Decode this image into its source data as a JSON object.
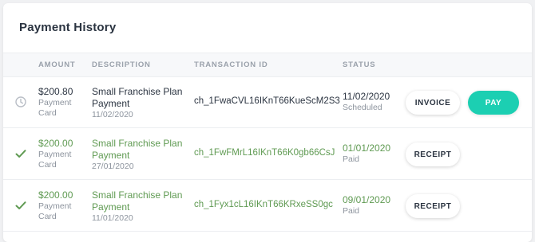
{
  "card": {
    "title": "Payment History"
  },
  "columns": {
    "amount": "AMOUNT",
    "description": "DESCRIPTION",
    "transaction_id": "TRANSACTION ID",
    "status": "STATUS"
  },
  "rows": [
    {
      "status_icon": "clock-icon",
      "amount": "$200.80",
      "method_line1": "Payment",
      "method_line2": "Card",
      "desc_line1": "Small Franchise Plan",
      "desc_line2": "Payment",
      "desc_date": "11/02/2020",
      "transaction_id": "ch_1FwaCVL16IKnT66KueScM2S3",
      "status_date": "11/02/2020",
      "status_label": "Scheduled",
      "action1": "INVOICE",
      "action2": "PAY"
    },
    {
      "status_icon": "check-icon",
      "amount": "$200.00",
      "method_line1": "Payment",
      "method_line2": "Card",
      "desc_line1": "Small Franchise Plan",
      "desc_line2": "Payment",
      "desc_date": "27/01/2020",
      "transaction_id": "ch_1FwFMrL16IKnT66K0gb66CsJ",
      "status_date": "01/01/2020",
      "status_label": "Paid",
      "action1": "RECEIPT"
    },
    {
      "status_icon": "check-icon",
      "amount": "$200.00",
      "method_line1": "Payment",
      "method_line2": "Card",
      "desc_line1": "Small Franchise Plan",
      "desc_line2": "Payment",
      "desc_date": "11/01/2020",
      "transaction_id": "ch_1Fyx1cL16IKnT66KRxeSS0gc",
      "status_date": "09/01/2020",
      "status_label": "Paid",
      "action1": "RECEIPT"
    }
  ],
  "colors": {
    "paid_green": "#5f9a52",
    "pay_button": "#1ccfb2",
    "scheduled_icon": "#b9bec6"
  }
}
